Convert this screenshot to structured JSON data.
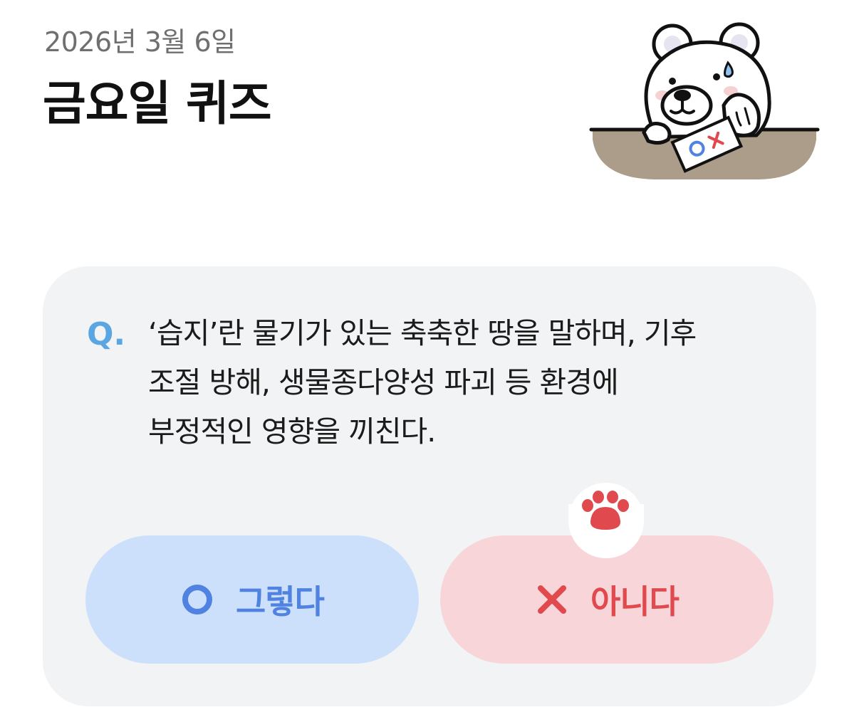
{
  "header": {
    "date": "2026년 3월 6일",
    "title": "금요일 퀴즈"
  },
  "illustration": {
    "name": "bear-thinking-icon",
    "card_text_o": "O",
    "card_text_x": "X"
  },
  "quiz": {
    "q_mark": "Q.",
    "question_lines": [
      "‘습지’란 물기가 있는 축축한 땅을 말하며, 기후",
      "조절 방해, 생물종다양성 파괴 등 환경에",
      "부정적인 영향을 끼친다."
    ]
  },
  "answers": {
    "yes": {
      "label": "그렇다",
      "icon": "circle-o-icon",
      "color": "#4f82e1",
      "bg": "#cde0fb"
    },
    "no": {
      "label": "아니다",
      "icon": "x-mark-icon",
      "color": "#e04a4f",
      "bg": "#f8d5d8"
    }
  },
  "colors": {
    "accent_blue": "#5aa6e3",
    "card_bg": "#f2f3f5",
    "date_gray": "#6f6f6f"
  }
}
